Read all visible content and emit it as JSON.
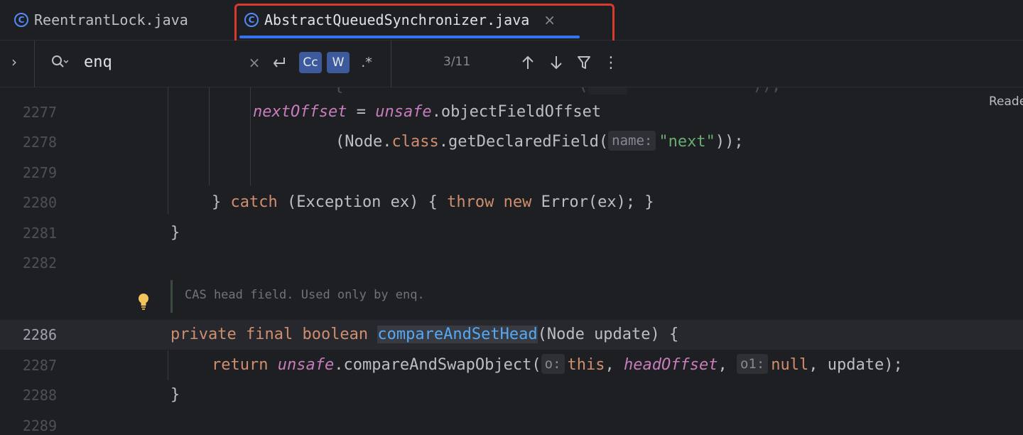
{
  "tabs": [
    {
      "label": "ReentrantLock.java",
      "icon": "class-icon",
      "active": false
    },
    {
      "label": "AbstractQueuedSynchronizer.java",
      "icon": "class-icon",
      "active": true,
      "close": "×"
    }
  ],
  "find": {
    "expand": "›",
    "query": "enq",
    "clear": "×",
    "case_label": "Cc",
    "word_label": "W",
    "regex_label": ".*",
    "match_count": "3/11",
    "more": "⋮"
  },
  "editor": {
    "reader_label": "Reade",
    "lines": [
      {
        "num": "2277"
      },
      {
        "num": "2278"
      },
      {
        "num": "2279"
      },
      {
        "num": "2280"
      },
      {
        "num": "2281"
      },
      {
        "num": "2282"
      },
      {
        "num": "2286"
      },
      {
        "num": "2287"
      },
      {
        "num": "2288"
      },
      {
        "num": "2289"
      }
    ],
    "l2277": {
      "field": "nextOffset",
      "eq": " = ",
      "obj": "unsafe",
      "rest": ".objectFieldOffset"
    },
    "l2278": {
      "pre": "(Node.",
      "kw": "class",
      "mid": ".getDeclaredField(",
      "hint": "name:",
      "str": "\"next\"",
      "post": "));"
    },
    "l2280": {
      "brace": "} ",
      "catch": "catch",
      "mid": " (Exception ex) { ",
      "throw": "throw",
      "sp": " ",
      "new": "new",
      "post": " Error(ex); }"
    },
    "l2281": {
      "text": "}"
    },
    "doc_comment": "CAS head field. Used only by enq.",
    "l2286": {
      "k1": "private",
      "k2": "final",
      "k3": "boolean",
      "method": "compareAndSetHead",
      "post": "(Node update) {"
    },
    "l2287": {
      "ret": "return",
      "obj": "unsafe",
      "call": ".compareAndSwapObject(",
      "hint1": "o:",
      "this": "this",
      "comma1": ", ",
      "field": "headOffset",
      "comma2": ", ",
      "hint2": "o1:",
      "null": "null",
      "post": ", update);"
    },
    "l2288": {
      "text": "}"
    }
  },
  "colors": {
    "keyword": "#cf8e6d",
    "field": "#c77dbb",
    "string": "#6aab73",
    "method": "#56a8f5",
    "accent": "#3574f0",
    "annotation_box": "#d83a2e"
  }
}
